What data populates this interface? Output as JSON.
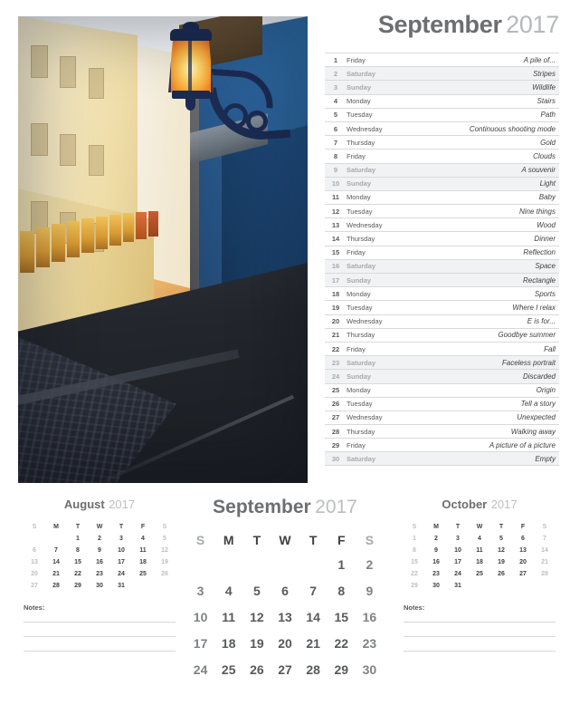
{
  "photo": {
    "alt_name": "narrow-european-street-with-street-lamp-photo"
  },
  "header": {
    "month": "September",
    "year": "2017"
  },
  "day_list": [
    {
      "num": "1",
      "day": "Friday",
      "note": "A pile of...",
      "weekend": false
    },
    {
      "num": "2",
      "day": "Saturday",
      "note": "Stripes",
      "weekend": true
    },
    {
      "num": "3",
      "day": "Sunday",
      "note": "Wildlife",
      "weekend": true
    },
    {
      "num": "4",
      "day": "Monday",
      "note": "Stairs",
      "weekend": false
    },
    {
      "num": "5",
      "day": "Tuesday",
      "note": "Path",
      "weekend": false
    },
    {
      "num": "6",
      "day": "Wednesday",
      "note": "Continuous shooting mode",
      "weekend": false
    },
    {
      "num": "7",
      "day": "Thursday",
      "note": "Gold",
      "weekend": false
    },
    {
      "num": "8",
      "day": "Friday",
      "note": "Clouds",
      "weekend": false
    },
    {
      "num": "9",
      "day": "Saturday",
      "note": "A souvenir",
      "weekend": true
    },
    {
      "num": "10",
      "day": "Sunday",
      "note": "Light",
      "weekend": true
    },
    {
      "num": "11",
      "day": "Monday",
      "note": "Baby",
      "weekend": false
    },
    {
      "num": "12",
      "day": "Tuesday",
      "note": "Nine things",
      "weekend": false
    },
    {
      "num": "13",
      "day": "Wednesday",
      "note": "Wood",
      "weekend": false
    },
    {
      "num": "14",
      "day": "Thursday",
      "note": "Dinner",
      "weekend": false
    },
    {
      "num": "15",
      "day": "Friday",
      "note": "Reflection",
      "weekend": false
    },
    {
      "num": "16",
      "day": "Saturday",
      "note": "Space",
      "weekend": true
    },
    {
      "num": "17",
      "day": "Sunday",
      "note": "Rectangle",
      "weekend": true
    },
    {
      "num": "18",
      "day": "Monday",
      "note": "Sports",
      "weekend": false
    },
    {
      "num": "19",
      "day": "Tuesday",
      "note": "Where I relax",
      "weekend": false
    },
    {
      "num": "20",
      "day": "Wednesday",
      "note": "E is for...",
      "weekend": false
    },
    {
      "num": "21",
      "day": "Thursday",
      "note": "Goodbye summer",
      "weekend": false
    },
    {
      "num": "22",
      "day": "Friday",
      "note": "Fall",
      "weekend": false
    },
    {
      "num": "23",
      "day": "Saturday",
      "note": "Faceless portrait",
      "weekend": true
    },
    {
      "num": "24",
      "day": "Sunday",
      "note": "Discarded",
      "weekend": true
    },
    {
      "num": "25",
      "day": "Monday",
      "note": "Origin",
      "weekend": false
    },
    {
      "num": "26",
      "day": "Tuesday",
      "note": "Tell a story",
      "weekend": false
    },
    {
      "num": "27",
      "day": "Wednesday",
      "note": "Unexpected",
      "weekend": false
    },
    {
      "num": "28",
      "day": "Thursday",
      "note": "Walking away",
      "weekend": false
    },
    {
      "num": "29",
      "day": "Friday",
      "note": "A picture of a picture",
      "weekend": false
    },
    {
      "num": "30",
      "day": "Saturday",
      "note": "Empty",
      "weekend": true
    }
  ],
  "weekday_initials": [
    "S",
    "M",
    "T",
    "W",
    "T",
    "F",
    "S"
  ],
  "prev_month": {
    "name": "August",
    "year": "2017",
    "weeks": [
      [
        "",
        "",
        "1",
        "2",
        "3",
        "4",
        "5"
      ],
      [
        "6",
        "7",
        "8",
        "9",
        "10",
        "11",
        "12"
      ],
      [
        "13",
        "14",
        "15",
        "16",
        "17",
        "18",
        "19"
      ],
      [
        "20",
        "21",
        "22",
        "23",
        "24",
        "25",
        "26"
      ],
      [
        "27",
        "28",
        "29",
        "30",
        "31",
        "",
        ""
      ]
    ]
  },
  "main_month": {
    "name": "September",
    "year": "2017",
    "weeks": [
      [
        "",
        "",
        "",
        "",
        "",
        "1",
        "2"
      ],
      [
        "3",
        "4",
        "5",
        "6",
        "7",
        "8",
        "9"
      ],
      [
        "10",
        "11",
        "12",
        "13",
        "14",
        "15",
        "16"
      ],
      [
        "17",
        "18",
        "19",
        "20",
        "21",
        "22",
        "23"
      ],
      [
        "24",
        "25",
        "26",
        "27",
        "28",
        "29",
        "30"
      ]
    ]
  },
  "next_month": {
    "name": "October",
    "year": "2017",
    "weeks": [
      [
        "1",
        "2",
        "3",
        "4",
        "5",
        "6",
        "7"
      ],
      [
        "8",
        "9",
        "10",
        "11",
        "12",
        "13",
        "14"
      ],
      [
        "15",
        "16",
        "17",
        "18",
        "19",
        "20",
        "21"
      ],
      [
        "22",
        "23",
        "24",
        "25",
        "26",
        "27",
        "28"
      ],
      [
        "29",
        "30",
        "31",
        "",
        "",
        "",
        ""
      ]
    ]
  },
  "notes": {
    "label": "Notes:",
    "line_count": 3
  },
  "colors": {
    "heading_dark": "#6d6e71",
    "heading_light": "#b6b8ba",
    "text": "#414042",
    "muted": "#a7a9ac",
    "rule": "#d9dadb",
    "weekend_row_bg": "#f1f2f3"
  }
}
